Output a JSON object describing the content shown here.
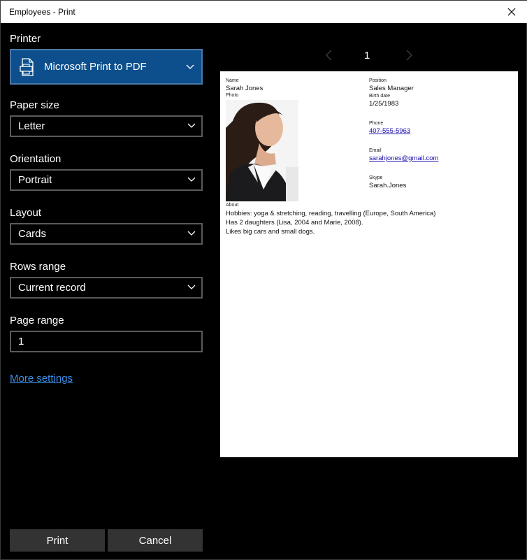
{
  "window": {
    "title": "Employees - Print"
  },
  "settings": {
    "printer_label": "Printer",
    "printer_value": "Microsoft Print to PDF",
    "paper_size_label": "Paper size",
    "paper_size_value": "Letter",
    "orientation_label": "Orientation",
    "orientation_value": "Portrait",
    "layout_label": "Layout",
    "layout_value": "Cards",
    "rows_range_label": "Rows range",
    "rows_range_value": "Current record",
    "page_range_label": "Page range",
    "page_range_value": "1",
    "more_settings": "More settings"
  },
  "buttons": {
    "print": "Print",
    "cancel": "Cancel"
  },
  "pager": {
    "current": "1"
  },
  "preview": {
    "name_label": "Name",
    "name": "Sarah Jones",
    "photo_label": "Photo",
    "position_label": "Position",
    "position": "Sales Manager",
    "birth_label": "Birth date",
    "birth": "1/25/1983",
    "phone_label": "Phone",
    "phone": "407-555-5963",
    "email_label": "Email",
    "email": "sarahjones@gmail.com",
    "skype_label": "Skype",
    "skype": "Sarah.Jones",
    "about_label": "About",
    "about_lines": [
      "Hobbies: yoga & stretching, reading, travelling (Europe, South America)",
      "Has 2 daughters (Lisa, 2004 and Marie, 2008).",
      "Likes big cars and small dogs."
    ]
  },
  "colors": {
    "accent": "#0c4f8c",
    "link": "#3b8ee6",
    "button": "#333333"
  }
}
